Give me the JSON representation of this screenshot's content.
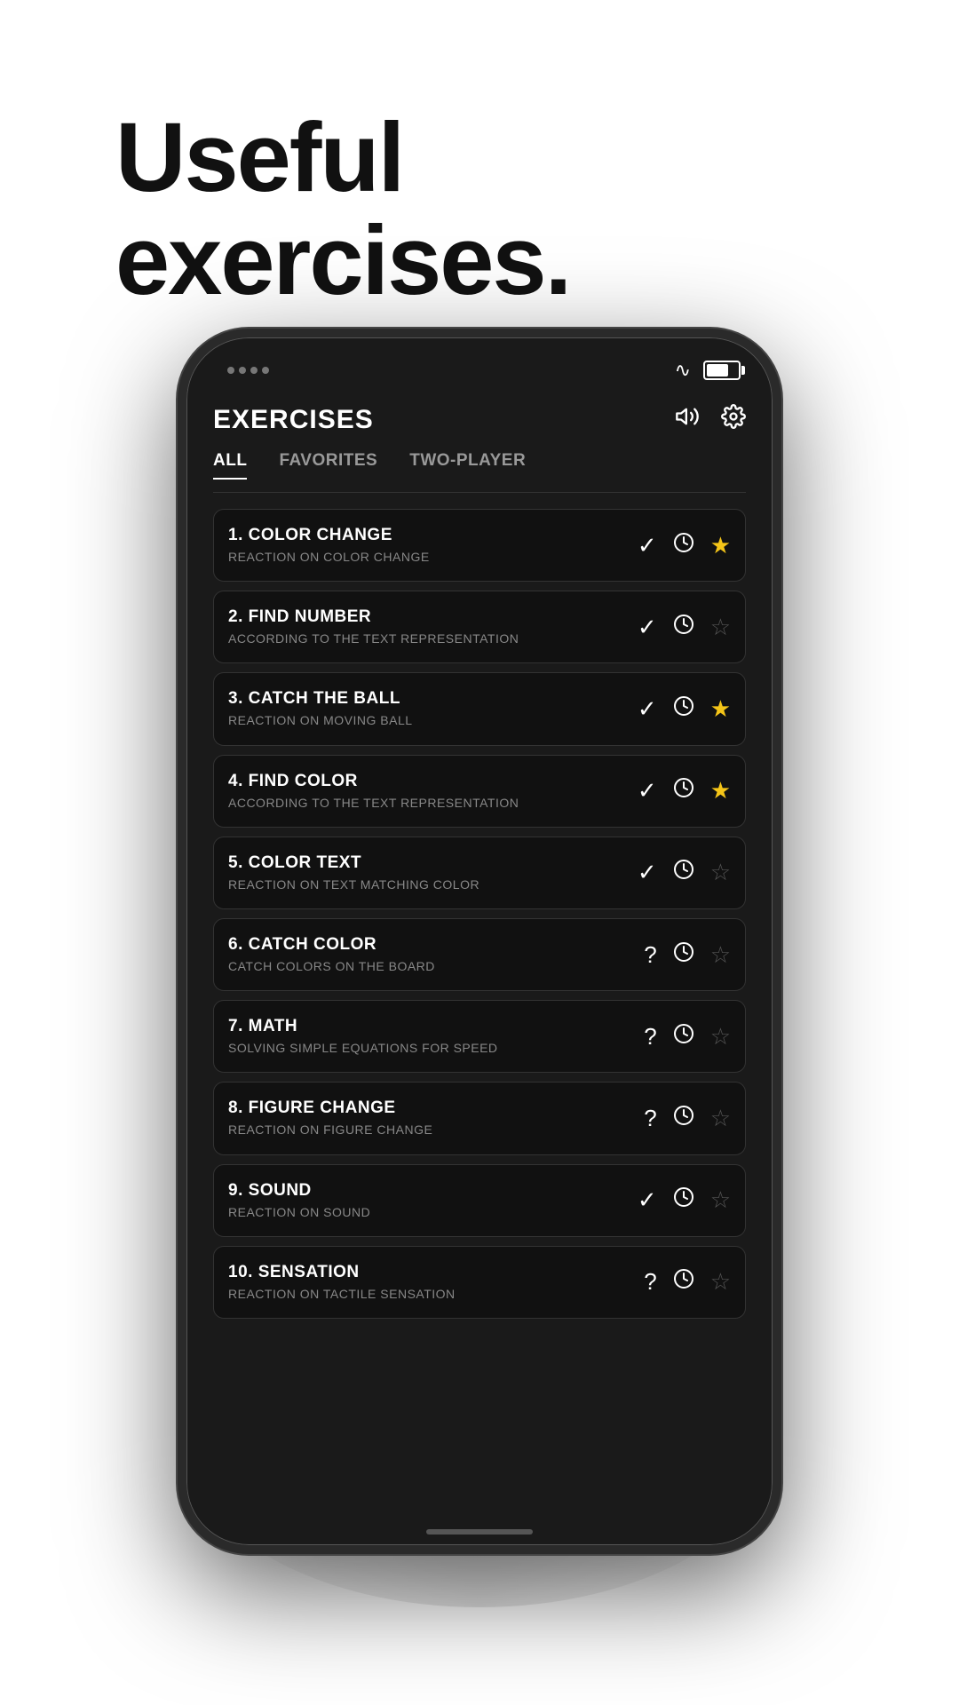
{
  "hero": {
    "title_line1": "Useful",
    "title_line2": "exercises."
  },
  "app": {
    "title": "EXERCISES",
    "header_icons": {
      "volume": "🔊",
      "settings": "⚙"
    },
    "tabs": [
      {
        "label": "ALL",
        "active": true
      },
      {
        "label": "FAVORITES",
        "active": false
      },
      {
        "label": "TWO-PLAYER",
        "active": false
      }
    ],
    "exercises": [
      {
        "number": "1.",
        "name": "COLOR CHANGE",
        "subtitle": "REACTION ON COLOR CHANGE",
        "status": "check",
        "favorited": true
      },
      {
        "number": "2.",
        "name": "FIND NUMBER",
        "subtitle": "ACCORDING TO THE TEXT REPRESENTATION",
        "status": "check",
        "favorited": false
      },
      {
        "number": "3.",
        "name": "CATCH THE BALL",
        "subtitle": "REACTION ON MOVING BALL",
        "status": "check",
        "favorited": true
      },
      {
        "number": "4.",
        "name": "FIND COLOR",
        "subtitle": "ACCORDING TO THE TEXT REPRESENTATION",
        "status": "check",
        "favorited": true
      },
      {
        "number": "5.",
        "name": "COLOR TEXT",
        "subtitle": "REACTION ON TEXT MATCHING COLOR",
        "status": "check",
        "favorited": false
      },
      {
        "number": "6.",
        "name": "CATCH COLOR",
        "subtitle": "CATCH COLORS ON THE BOARD",
        "status": "question",
        "favorited": false
      },
      {
        "number": "7.",
        "name": "MATH",
        "subtitle": "SOLVING SIMPLE EQUATIONS FOR SPEED",
        "status": "question",
        "favorited": false
      },
      {
        "number": "8.",
        "name": "FIGURE CHANGE",
        "subtitle": "REACTION ON FIGURE CHANGE",
        "status": "question",
        "favorited": false
      },
      {
        "number": "9.",
        "name": "SOUND",
        "subtitle": "REACTION ON SOUND",
        "status": "check",
        "favorited": false
      },
      {
        "number": "10.",
        "name": "SENSATION",
        "subtitle": "REACTION ON TACTILE SENSATION",
        "status": "question",
        "favorited": false
      }
    ]
  }
}
